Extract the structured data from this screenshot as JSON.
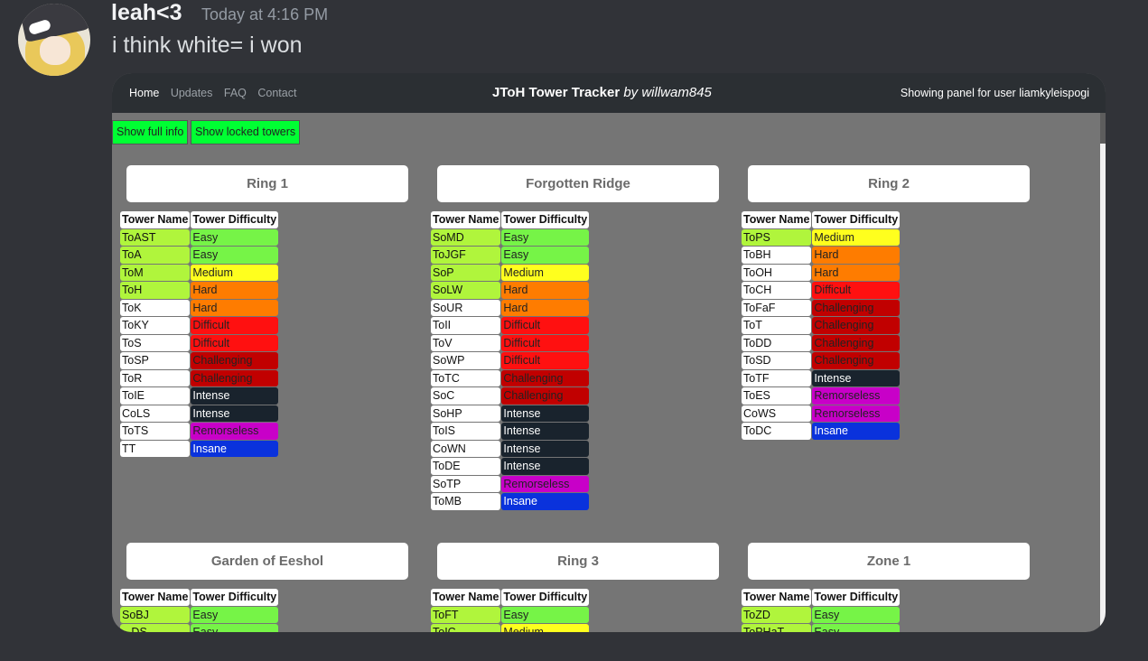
{
  "message": {
    "username": "leah<3",
    "timestamp": "Today at 4:16 PM",
    "text": "i think white= i won"
  },
  "app": {
    "nav_links": [
      "Home",
      "Updates",
      "FAQ",
      "Contact"
    ],
    "title": "JToH Tower Tracker",
    "title_by": "by willwam845",
    "panel_user": "Showing panel for user liamkyleispogi",
    "buttons": {
      "show_full_info": "Show full info",
      "show_locked": "Show locked towers"
    },
    "col_name": "Tower Name",
    "col_diff": "Tower Difficulty"
  },
  "difficulty_colors": {
    "Easy": {
      "bg": "#76f447",
      "fg": "#222"
    },
    "Medium": {
      "bg": "#ffff1e",
      "fg": "#222"
    },
    "Hard": {
      "bg": "#fe7c00",
      "fg": "#222"
    },
    "Difficult": {
      "bg": "#ff1010",
      "fg": "#222"
    },
    "Challenging": {
      "bg": "#c10000",
      "fg": "#222"
    },
    "Intense": {
      "bg": "#19232d",
      "fg": "#ffffff"
    },
    "Remorseless": {
      "bg": "#c800c8",
      "fg": "#222"
    },
    "Insane": {
      "bg": "#0a32dc",
      "fg": "#ffffff"
    }
  },
  "completed_color": "#b0f53c",
  "areas": [
    {
      "name": "Ring 1",
      "towers": [
        {
          "name": "ToAST",
          "difficulty": "Easy",
          "completed": true
        },
        {
          "name": "ToA",
          "difficulty": "Easy",
          "completed": true
        },
        {
          "name": "ToM",
          "difficulty": "Medium",
          "completed": true
        },
        {
          "name": "ToH",
          "difficulty": "Hard",
          "completed": true
        },
        {
          "name": "ToK",
          "difficulty": "Hard",
          "completed": false
        },
        {
          "name": "ToKY",
          "difficulty": "Difficult",
          "completed": false
        },
        {
          "name": "ToS",
          "difficulty": "Difficult",
          "completed": false
        },
        {
          "name": "ToSP",
          "difficulty": "Challenging",
          "completed": false
        },
        {
          "name": "ToR",
          "difficulty": "Challenging",
          "completed": false
        },
        {
          "name": "ToIE",
          "difficulty": "Intense",
          "completed": false
        },
        {
          "name": "CoLS",
          "difficulty": "Intense",
          "completed": false
        },
        {
          "name": "ToTS",
          "difficulty": "Remorseless",
          "completed": false
        },
        {
          "name": "TT",
          "difficulty": "Insane",
          "completed": false
        }
      ]
    },
    {
      "name": "Forgotten Ridge",
      "towers": [
        {
          "name": "SoMD",
          "difficulty": "Easy",
          "completed": true
        },
        {
          "name": "ToJGF",
          "difficulty": "Easy",
          "completed": true
        },
        {
          "name": "SoP",
          "difficulty": "Medium",
          "completed": true
        },
        {
          "name": "SoLW",
          "difficulty": "Hard",
          "completed": true
        },
        {
          "name": "SoUR",
          "difficulty": "Hard",
          "completed": false
        },
        {
          "name": "ToII",
          "difficulty": "Difficult",
          "completed": false
        },
        {
          "name": "ToV",
          "difficulty": "Difficult",
          "completed": false
        },
        {
          "name": "SoWP",
          "difficulty": "Difficult",
          "completed": false
        },
        {
          "name": "ToTC",
          "difficulty": "Challenging",
          "completed": false
        },
        {
          "name": "SoC",
          "difficulty": "Challenging",
          "completed": false
        },
        {
          "name": "SoHP",
          "difficulty": "Intense",
          "completed": false
        },
        {
          "name": "ToIS",
          "difficulty": "Intense",
          "completed": false
        },
        {
          "name": "CoWN",
          "difficulty": "Intense",
          "completed": false
        },
        {
          "name": "ToDE",
          "difficulty": "Intense",
          "completed": false
        },
        {
          "name": "SoTP",
          "difficulty": "Remorseless",
          "completed": false
        },
        {
          "name": "ToMB",
          "difficulty": "Insane",
          "completed": false
        }
      ]
    },
    {
      "name": "Ring 2",
      "towers": [
        {
          "name": "ToPS",
          "difficulty": "Medium",
          "completed": true
        },
        {
          "name": "ToBH",
          "difficulty": "Hard",
          "completed": false
        },
        {
          "name": "ToOH",
          "difficulty": "Hard",
          "completed": false
        },
        {
          "name": "ToCH",
          "difficulty": "Difficult",
          "completed": false
        },
        {
          "name": "ToFaF",
          "difficulty": "Challenging",
          "completed": false
        },
        {
          "name": "ToT",
          "difficulty": "Challenging",
          "completed": false
        },
        {
          "name": "ToDD",
          "difficulty": "Challenging",
          "completed": false
        },
        {
          "name": "ToSD",
          "difficulty": "Challenging",
          "completed": false
        },
        {
          "name": "ToTF",
          "difficulty": "Intense",
          "completed": false
        },
        {
          "name": "ToES",
          "difficulty": "Remorseless",
          "completed": false
        },
        {
          "name": "CoWS",
          "difficulty": "Remorseless",
          "completed": false
        },
        {
          "name": "ToDC",
          "difficulty": "Insane",
          "completed": false
        }
      ]
    },
    {
      "name": "Garden of Eeshol",
      "towers": [
        {
          "name": "SoBJ",
          "difficulty": "Easy",
          "completed": true
        },
        {
          "name": "...DS",
          "difficulty": "Easy",
          "completed": true
        }
      ]
    },
    {
      "name": "Ring 3",
      "towers": [
        {
          "name": "ToFT",
          "difficulty": "Easy",
          "completed": true
        },
        {
          "name": "ToIC",
          "difficulty": "Medium",
          "completed": true
        }
      ]
    },
    {
      "name": "Zone 1",
      "towers": [
        {
          "name": "ToZD",
          "difficulty": "Easy",
          "completed": true
        },
        {
          "name": "ToPHaT",
          "difficulty": "Easy",
          "completed": true
        }
      ]
    }
  ]
}
